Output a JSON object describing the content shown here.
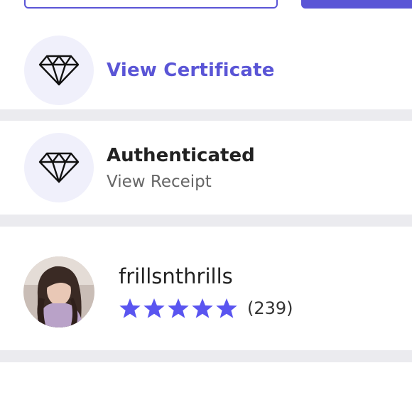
{
  "colors": {
    "accent": "#5a55d6",
    "icon_bg": "#f0f0fb",
    "divider": "#ebebef"
  },
  "certificate": {
    "link_label": "View Certificate",
    "icon": "diamond-icon"
  },
  "authentication": {
    "title": "Authenticated",
    "subtitle": "View Receipt",
    "icon": "diamond-icon"
  },
  "seller": {
    "username": "frillsnthrills",
    "rating_stars": 5,
    "review_count": "(239)"
  }
}
